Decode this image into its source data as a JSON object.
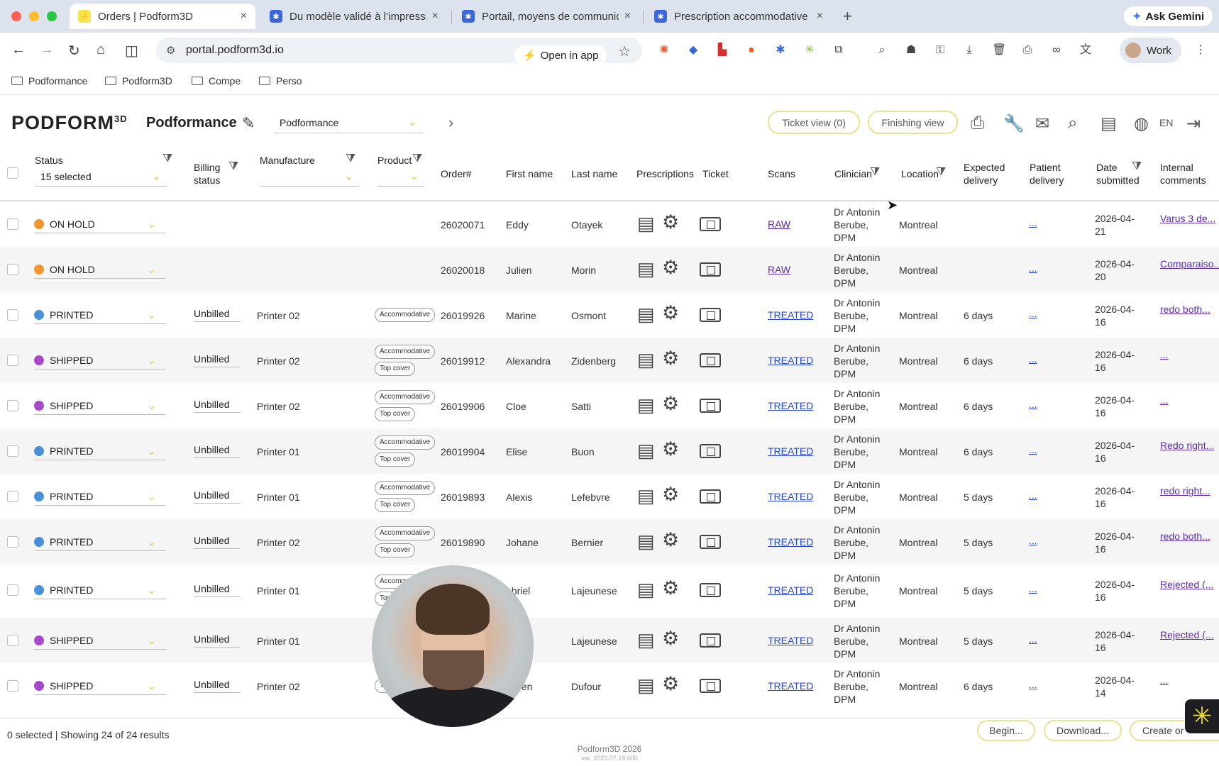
{
  "browser": {
    "tabs": [
      {
        "title": "Orders | Podform3D",
        "active": true
      },
      {
        "title": "Du modèle validé à l’impressi",
        "active": false
      },
      {
        "title": "Portail, moyens de communic",
        "active": false
      },
      {
        "title": "Prescription accommodative",
        "active": false
      }
    ],
    "gemini_label": "Ask Gemini",
    "url": "portal.podform3d.io",
    "open_in_app": "Open in app",
    "profile": "Work",
    "bookmarks": [
      "Podformance",
      "Podform3D",
      "Compe",
      "Perso"
    ]
  },
  "app": {
    "logo": "PODFORM",
    "logo_sup": "3D",
    "org_name": "Podformance",
    "org_select": "Podformance",
    "ticket_view": "Ticket view (0)",
    "finishing_view": "Finishing view",
    "lang": "EN"
  },
  "columns": {
    "status": "Status",
    "status_filter_value": "15 selected",
    "billing": "Billing status",
    "manufacture": "Manufacture",
    "product": "Product",
    "order": "Order#",
    "first": "First name",
    "last": "Last name",
    "prescriptions": "Prescriptions",
    "ticket": "Ticket",
    "scans": "Scans",
    "clinician": "Clinician",
    "location": "Location",
    "expected": "Expected delivery",
    "patient": "Patient delivery",
    "date": "Date submitted",
    "comments": "Internal comments"
  },
  "status_colors": {
    "ON HOLD": "#f0962c",
    "PRINTED": "#4a90d9",
    "SHIPPED": "#a64ac9"
  },
  "rows": [
    {
      "status": "ON HOLD",
      "billing": "",
      "manufacture": "",
      "tags": [],
      "order": "26020071",
      "first": "Eddy",
      "last": "Otayek",
      "scans": "RAW",
      "clinician": "Dr Antonin Berube, DPM",
      "location": "Montreal",
      "expected": "",
      "patient": "...",
      "date": "2026-04-21",
      "comment": "Varus 3 de..."
    },
    {
      "status": "ON HOLD",
      "billing": "",
      "manufacture": "",
      "tags": [],
      "order": "26020018",
      "first": "Julien",
      "last": "Morin",
      "scans": "RAW",
      "clinician": "Dr Antonin Berube, DPM",
      "location": "Montreal",
      "expected": "",
      "patient": "...",
      "date": "2026-04-20",
      "comment": "Comparaiso..."
    },
    {
      "status": "PRINTED",
      "billing": "Unbilled",
      "manufacture": "Printer 02",
      "tags": [
        "Accommodative"
      ],
      "order": "26019926",
      "first": "Marine",
      "last": "Osmont",
      "scans": "TREATED",
      "clinician": "Dr Antonin Berube, DPM",
      "location": "Montreal",
      "expected": "6 days",
      "patient": "...",
      "date": "2026-04-16",
      "comment": "redo both..."
    },
    {
      "status": "SHIPPED",
      "billing": "Unbilled",
      "manufacture": "Printer 02",
      "tags": [
        "Accommodative",
        "Top cover"
      ],
      "order": "26019912",
      "first": "Alexandra",
      "last": "Zidenberg",
      "scans": "TREATED",
      "clinician": "Dr Antonin Berube, DPM",
      "location": "Montreal",
      "expected": "6 days",
      "patient": "...",
      "date": "2026-04-16",
      "comment": "..."
    },
    {
      "status": "SHIPPED",
      "billing": "Unbilled",
      "manufacture": "Printer 02",
      "tags": [
        "Accommodative",
        "Top cover"
      ],
      "order": "26019906",
      "first": "Cloe",
      "last": "Satti",
      "scans": "TREATED",
      "clinician": "Dr Antonin Berube, DPM",
      "location": "Montreal",
      "expected": "6 days",
      "patient": "...",
      "date": "2026-04-16",
      "comment": "..."
    },
    {
      "status": "PRINTED",
      "billing": "Unbilled",
      "manufacture": "Printer 01",
      "tags": [
        "Accommodative",
        "Top cover"
      ],
      "order": "26019904",
      "first": "Elise",
      "last": "Buon",
      "scans": "TREATED",
      "clinician": "Dr Antonin Berube, DPM",
      "location": "Montreal",
      "expected": "6 days",
      "patient": "...",
      "date": "2026-04-16",
      "comment": "Redo right..."
    },
    {
      "status": "PRINTED",
      "billing": "Unbilled",
      "manufacture": "Printer 01",
      "tags": [
        "Accommodative",
        "Top cover"
      ],
      "order": "26019893",
      "first": "Alexis",
      "last": "Lefebvre",
      "scans": "TREATED",
      "clinician": "Dr Antonin Berube, DPM",
      "location": "Montreal",
      "expected": "5 days",
      "patient": "...",
      "date": "2026-04-16",
      "comment": "redo right..."
    },
    {
      "status": "PRINTED",
      "billing": "Unbilled",
      "manufacture": "Printer 02",
      "tags": [
        "Accommodative",
        "Top cover"
      ],
      "order": "26019890",
      "first": "Johane",
      "last": "Bernier",
      "scans": "TREATED",
      "clinician": "Dr Antonin Berube, DPM",
      "location": "Montreal",
      "expected": "5 days",
      "patient": "...",
      "date": "2026-04-16",
      "comment": "redo both..."
    },
    {
      "status": "PRINTED",
      "billing": "Unbilled",
      "manufacture": "Printer 01",
      "tags": [
        "Accommoda",
        "Top"
      ],
      "order": "",
      "first": "abriel",
      "last": "Lajeunese",
      "scans": "TREATED",
      "clinician": "Dr Antonin Berube, DPM",
      "location": "Montreal",
      "expected": "5 days",
      "patient": "...",
      "date": "2026-04-16",
      "comment": "Rejected (..."
    },
    {
      "status": "SHIPPED",
      "billing": "Unbilled",
      "manufacture": "Printer 01",
      "tags": [],
      "order": "",
      "first": "el",
      "last": "Lajeunese",
      "scans": "TREATED",
      "clinician": "Dr Antonin Berube, DPM",
      "location": "Montreal",
      "expected": "5 days",
      "patient": "...",
      "date": "2026-04-16",
      "comment": "Rejected (..."
    },
    {
      "status": "SHIPPED",
      "billing": "Unbilled",
      "manufacture": "Printer 02",
      "tags": [
        "To"
      ],
      "order": "",
      "first": "astien",
      "last": "Dufour",
      "scans": "TREATED",
      "clinician": "Dr Antonin Berube, DPM",
      "location": "Montreal",
      "expected": "6 days",
      "patient": "...",
      "date": "2026-04-14",
      "comment": "..."
    }
  ],
  "footer": {
    "summary": "0 selected | Showing 24 of 24 results",
    "begin": "Begin...",
    "download": "Download...",
    "create": "Create or",
    "copyright": "Podform3D 2026",
    "version": "ver. 2023.07.19.000"
  }
}
